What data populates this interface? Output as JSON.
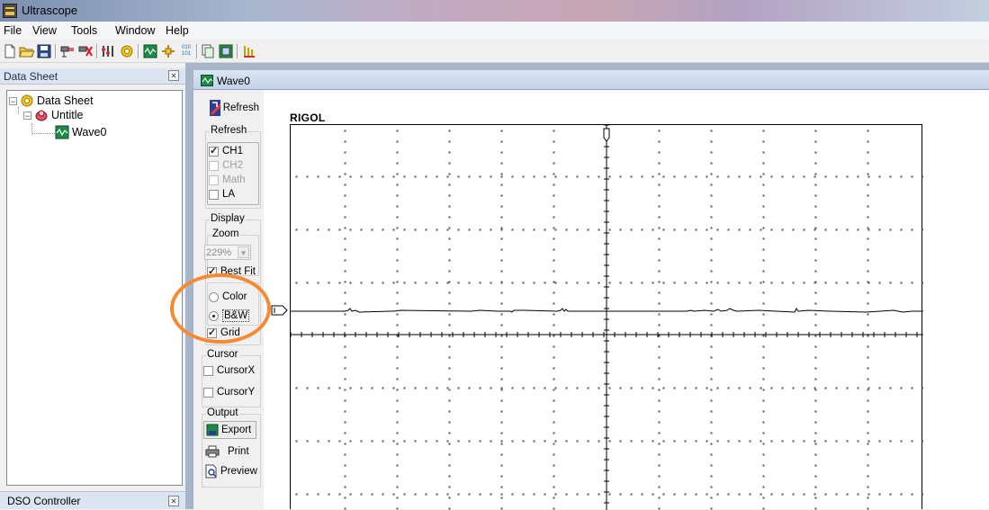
{
  "app": {
    "title": "Ultrascope"
  },
  "menu": [
    "File",
    "View",
    "Tools",
    "Window",
    "Help"
  ],
  "toolbar": {
    "icons": [
      "new-icon",
      "open-icon",
      "save-icon",
      "connect-icon",
      "disconnect-icon",
      "tools-icon",
      "settings-icon",
      "waveform-icon",
      "cursor-icon",
      "binary-data-icon",
      "copy-icon",
      "measure-icon",
      "record-icon"
    ],
    "binary_glyph_top": "010",
    "binary_glyph_bottom": "101"
  },
  "datasheet_panel": {
    "title": "Data Sheet",
    "tree": {
      "root": "Data Sheet",
      "child": "Untitle",
      "leaf": "Wave0"
    }
  },
  "dso_panel": {
    "title": "DSO Controller"
  },
  "child_window": {
    "title": "Wave0"
  },
  "controls": {
    "refresh_button": "Refresh",
    "refresh_group": "Refresh",
    "channels": [
      {
        "label": "CH1",
        "checked": true,
        "enabled": true
      },
      {
        "label": "CH2",
        "checked": false,
        "enabled": false
      },
      {
        "label": "Math",
        "checked": false,
        "enabled": false
      },
      {
        "label": "LA",
        "checked": false,
        "enabled": true
      }
    ],
    "display_group": "Display",
    "zoom_group": "Zoom",
    "zoom_value": "229%",
    "best_fit": "Best Fit",
    "color_label": "Color",
    "bw_label": "B&W",
    "grid_label": "Grid",
    "cursor_group": "Cursor",
    "cursor_x": "CursorX",
    "cursor_y": "CursorY",
    "output_group": "Output",
    "export": "Export",
    "print": "Print",
    "preview": "Preview"
  },
  "scope": {
    "brand": "RIGOL"
  },
  "colors": {
    "highlight": "#f58a33",
    "mdi_bg": "#a7b5c9"
  }
}
